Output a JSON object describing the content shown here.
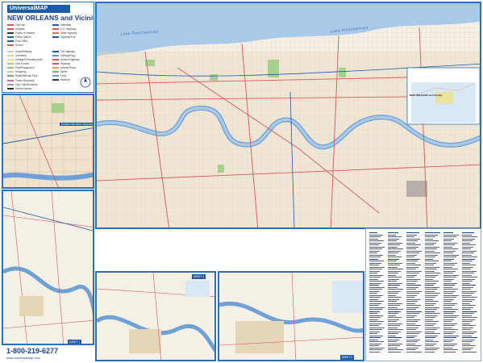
{
  "legend": {
    "brand": "UniversalMAP",
    "title": "NEW ORLEANS and Vicinity",
    "items": [
      "City Hall",
      "Hospital",
      "Points of Interest",
      "Police Station",
      "Post Office",
      "School",
      "Airport/Military",
      "Cemetery",
      "College/University Area",
      "Golf Course",
      "Park/Playground",
      "Shopping",
      "State/National Park",
      "Parish Boundary",
      "City Limit Boundary",
      "Street Number"
    ],
    "symbols": [
      "Interstate",
      "U.S. Highway",
      "State Highway",
      "Highway Exit",
      "Toll Highway",
      "Tollway/Expy",
      "Divided Highway",
      "Highway",
      "Arterial Road",
      "Street",
      "Ferry",
      "Railroad"
    ]
  },
  "labels": {
    "lake": "Lake Pontchartrain",
    "downtown": "DOWNTOWN NEW ORLEANS",
    "inset_main": "NEW ORLEANS and Vicinity",
    "inset_tag_1": "INSET 1",
    "inset_tag_2": "INSET 2",
    "inset_tag_3": "INSET 3",
    "phone": "1-800-219-6277",
    "web": "www.universalmap.com"
  },
  "colors": {
    "border": "#2f6fb8",
    "land": "#f4f0e6",
    "water": "#a9c9e8",
    "river": "#6fa0d6",
    "roads": "#d9585a",
    "parks": "#a8d08d",
    "urban": "#e6d6b8"
  }
}
